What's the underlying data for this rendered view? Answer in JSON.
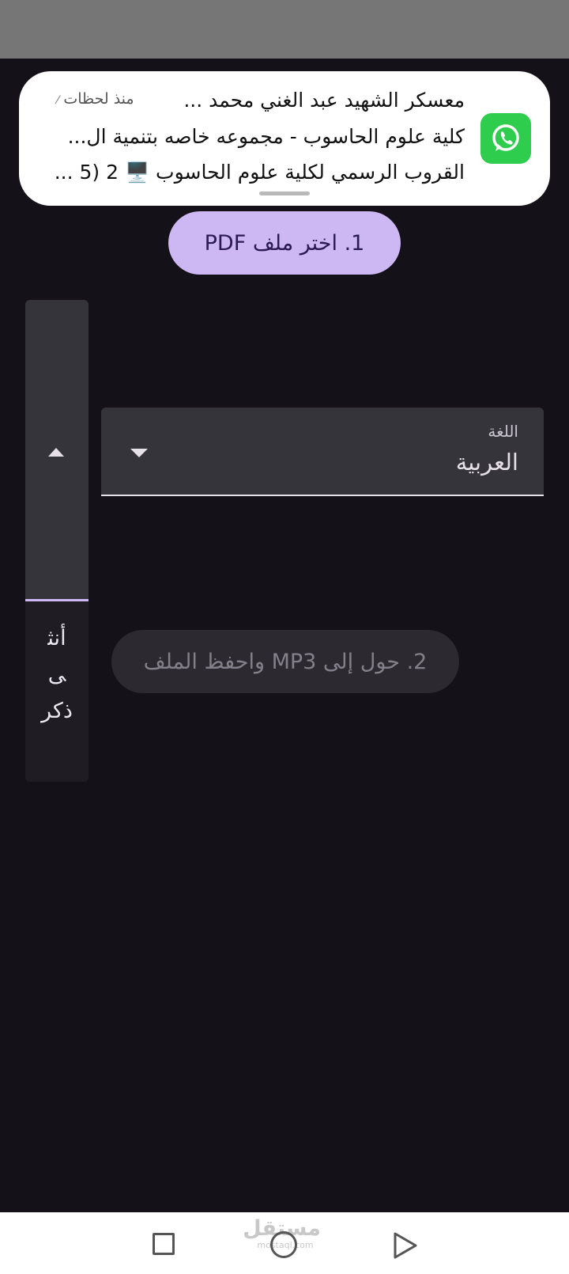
{
  "notification": {
    "app_icon": "whatsapp-icon",
    "title_line": "معسكر الشهيد عبد الغني محمد ...",
    "time": "منذ لحظات",
    "line2": "كلية علوم الحاسوب - مجموعه خاصه بتنمية ال...",
    "line3": "القروب الرسمي لكلية علوم الحاسوب 🖥️ 2 (5 ..."
  },
  "main": {
    "pick_pdf_label": "1. اختر ملف PDF",
    "voice": {
      "options": [
        "أنثى",
        "ذكر"
      ]
    },
    "language": {
      "label": "اللغة",
      "value": "العربية"
    },
    "convert_label": "2. حول إلى MP3 واحفظ الملف"
  },
  "navbar": {
    "recents_icon": "square-icon",
    "home_icon": "circle-icon",
    "back_icon": "triangle-icon"
  },
  "watermark": {
    "main": "مستقل",
    "sub": "mostaql.com"
  },
  "colors": {
    "background": "#141218",
    "accent": "#cdb8f4",
    "whatsapp": "#2fcd4e"
  }
}
